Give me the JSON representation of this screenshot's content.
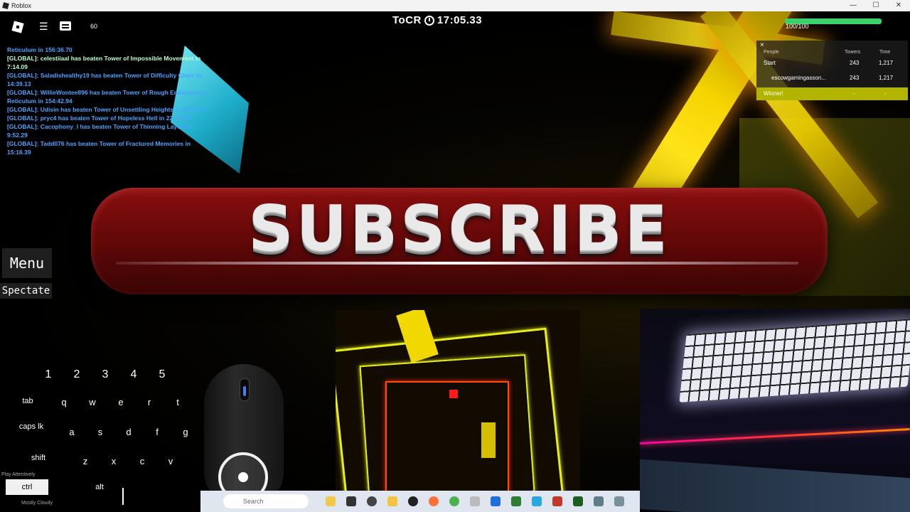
{
  "window": {
    "title": "Roblox",
    "controls": [
      "—",
      "☐",
      "✕"
    ]
  },
  "hud": {
    "fps": "60",
    "timer_label": "ToCR",
    "timer_value": "17:05.33",
    "health_text": "100/100",
    "health_fraction": 1.0
  },
  "chat": [
    {
      "text": "Reticulum in 156:36.70",
      "alt": false
    },
    {
      "text": "[GLOBAL]: celestiiaal has beaten Tower of Impossible Movement in",
      "alt": true
    },
    {
      "text": "7:14.09",
      "alt": true
    },
    {
      "text": "[GLOBAL]: Saladishealthy19 has beaten Tower of Difficulty Chart in",
      "alt": false
    },
    {
      "text": "14:39.13",
      "alt": false
    },
    {
      "text": "[GLOBAL]: WillieWontee896 has beaten Tower of Rough Endoplasmic",
      "alt": false
    },
    {
      "text": "Reticulum in 154:42.94",
      "alt": false
    },
    {
      "text": "[GLOBAL]: Udisin has beaten Tower of Unsettling Heights in 18:29.??",
      "alt": false
    },
    {
      "text": "[GLOBAL]: pryc4 has beaten Tower of Hopeless Hell in 22:16.?6",
      "alt": false
    },
    {
      "text": "[GLOBAL]: Cacophony_I has beaten Tower of Thinning Layers in",
      "alt": false
    },
    {
      "text": "9:52.29",
      "alt": false
    },
    {
      "text": "[GLOBAL]: Tadd076 has beaten Tower of Fractured Memories in",
      "alt": false
    },
    {
      "text": "15:16.39",
      "alt": false
    }
  ],
  "leaderboard": {
    "close": "×",
    "headers": {
      "people": "People",
      "towers": "Towers",
      "time": "Time"
    },
    "rows": [
      {
        "name": "Start",
        "towers": "243",
        "time": "1,217"
      },
      {
        "name": "escowgamingasson...",
        "towers": "243",
        "time": "1,217"
      }
    ],
    "winner": {
      "name": "Winner!",
      "towers": "-",
      "time": "-"
    }
  },
  "banner": {
    "text": "SUBSCRIBE"
  },
  "buttons": {
    "menu": "Menu",
    "spectate": "Spectate"
  },
  "keyboard": {
    "numbers": [
      "1",
      "2",
      "3",
      "4",
      "5"
    ],
    "row1": [
      "tab",
      "q",
      "w",
      "e",
      "r",
      "t"
    ],
    "row2": [
      "caps lk",
      "a",
      "s",
      "d",
      "f",
      "g"
    ],
    "row3": [
      "shift",
      "z",
      "x",
      "c",
      "v"
    ],
    "row4": [
      "ctrl",
      "alt"
    ]
  },
  "taskbar": {
    "search_placeholder": "Search"
  },
  "overlay": {
    "left_text": "Play Attentively",
    "left_text2": "Mostly Cloudy"
  },
  "colors": {
    "chat_blue": "#4aa3ff",
    "chat_green": "#b9ffcf",
    "winner": "#b1b500",
    "health": "#3bd16a"
  }
}
